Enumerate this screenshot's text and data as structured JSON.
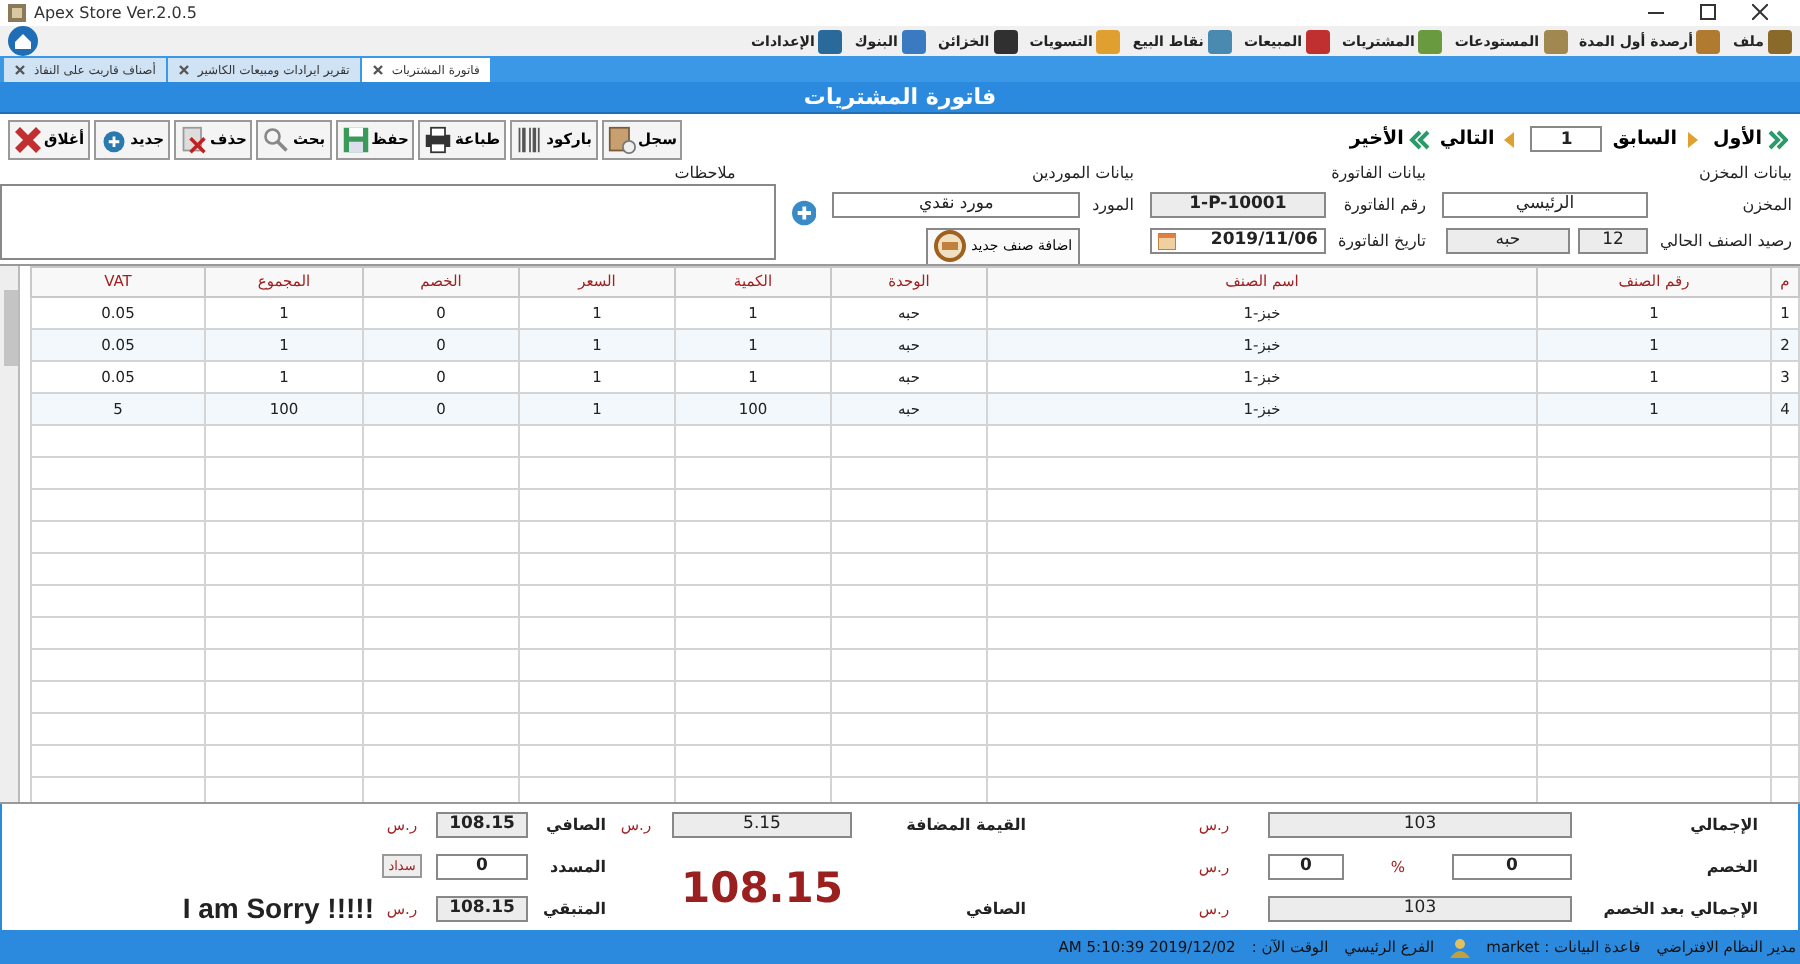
{
  "window": {
    "title": "Apex Store Ver.2.0.5"
  },
  "menu": [
    {
      "label": "ملف"
    },
    {
      "label": "أرصدة أول المدة"
    },
    {
      "label": "المستودعات"
    },
    {
      "label": "المشتريات"
    },
    {
      "label": "المبيعات"
    },
    {
      "label": "نقاط البيع"
    },
    {
      "label": "التسويات"
    },
    {
      "label": "الخزائن"
    },
    {
      "label": "البنوك"
    },
    {
      "label": "الإعدادات"
    }
  ],
  "tabs": [
    {
      "label": "فاتورة المشتريات",
      "selected": true
    },
    {
      "label": "تقرير ايرادات ومبيعات الكاشير",
      "selected": false
    },
    {
      "label": "أصناف قاربت على النفاذ",
      "selected": false
    }
  ],
  "form_title": "فاتورة المشتريات",
  "navigation": {
    "first": "الأول",
    "previous": "السابق",
    "record": "1",
    "next": "التالي",
    "last": "الأخير"
  },
  "toolbar": [
    {
      "label": "سجل",
      "kind": "log"
    },
    {
      "label": "باركود",
      "kind": "barcode"
    },
    {
      "label": "طباعة",
      "kind": "print"
    },
    {
      "label": "حفظ",
      "kind": "save"
    },
    {
      "label": "بحث",
      "kind": "search"
    },
    {
      "label": "حذف",
      "kind": "delete"
    },
    {
      "label": "جديد",
      "kind": "new"
    },
    {
      "label": "أغلاق",
      "kind": "close"
    }
  ],
  "store": {
    "heading": "بيانات المخزن",
    "label": "المخزن",
    "value": "الرئيسي",
    "balance_label": "رصيد الصنف الحالي",
    "balance": "12",
    "unit": "حبه"
  },
  "invoice": {
    "heading": "بيانات الفاتورة",
    "number_label": "رقم الفاتورة",
    "number": "1-P-10001",
    "date_label": "تاريخ الفاتورة",
    "date": "2019/11/06"
  },
  "supplier": {
    "heading": "بيانات الموردين",
    "label": "المورد",
    "value": "مورد نقدي",
    "add_item_button": "اضافة صنف جديد"
  },
  "notes": {
    "label": "ملاحظات"
  },
  "table": {
    "columns": [
      "م",
      "رقم الصنف",
      "اسم الصنف",
      "الوحدة",
      "الكمية",
      "السعر",
      "الخصم",
      "المجموع",
      "VAT"
    ],
    "rows": [
      [
        "1",
        "1",
        "خبز-1",
        "حبه",
        "1",
        "1",
        "0",
        "1",
        "0.05"
      ],
      [
        "2",
        "1",
        "خبز-1",
        "حبه",
        "1",
        "1",
        "0",
        "1",
        "0.05"
      ],
      [
        "3",
        "1",
        "خبز-1",
        "حبه",
        "1",
        "1",
        "0",
        "1",
        "0.05"
      ],
      [
        "4",
        "1",
        "خبز-1",
        "حبه",
        "100",
        "1",
        "0",
        "100",
        "5"
      ]
    ]
  },
  "totals": {
    "total_label": "الإجمالي",
    "total": "103",
    "total_unit": "ر.س",
    "discount_label": "الخصم",
    "discount_value": "0",
    "percent_sign": "%",
    "discount_amount": "0",
    "discount_unit": "ر.س",
    "after_discount_label": "الإجمالي بعد الخصم",
    "after_discount": "103",
    "after_discount_unit": "ر.س",
    "vat_label": "القيمة المضافة",
    "vat": "5.15",
    "vat_unit": "ر.س",
    "big_net": "108.15",
    "big_net_label": "الصافي",
    "net_label": "الصافي",
    "net": "108.15",
    "net_unit": "ر.س",
    "paid_label": "المسدد",
    "paid": "0",
    "pay_button": "سداد",
    "remaining_label": "المتبقي",
    "remaining": "108.15",
    "remaining_unit": "ر.س"
  },
  "message": "I am Sorry !!!!!",
  "status_bar": {
    "user": "مدير النظام الافتراضي",
    "database": "قاعدة البيانات : market",
    "branch": "الفرع الرئيسي",
    "time_label": "الوقت الآن :",
    "time": "AM 5:10:39 2019/12/02"
  }
}
